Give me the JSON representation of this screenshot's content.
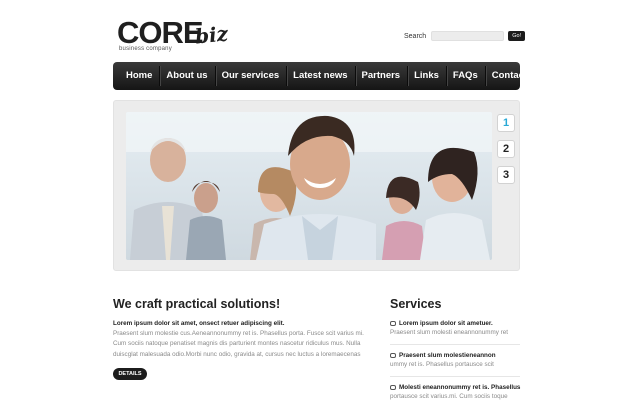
{
  "header": {
    "logo_main": "CORE",
    "logo_script": "biz",
    "tagline": "business company",
    "search_label": "Search",
    "search_value": "",
    "search_button": "Go!"
  },
  "nav": {
    "items": [
      "Home",
      "About us",
      "Our services",
      "Latest news",
      "Partners",
      "Links",
      "FAQs",
      "Contacts"
    ]
  },
  "slider": {
    "pager": [
      "1",
      "2",
      "3"
    ],
    "active_index": 1
  },
  "main": {
    "heading": "We craft practical solutions!",
    "lead": "Lorem ipsum dolor sit amet, onsect retuer adipiscing elit.",
    "body": "Praesent slum molestie cus.Aeneannonummy ret is. Phasellus porta. Fusce scit varius mi. Cum sociis natoque penatiset magnis dis parturient montes  nascetur ridiculus mus. Nulla duiscglat malesuada odio.Morbi nunc odio, gravida at, cursus nec luctus a loremaecenas",
    "details_button": "DETAILS"
  },
  "services": {
    "heading": "Services",
    "items": [
      {
        "title": "Lorem ipsum dolor sit ametuer.",
        "text": "Praesent slum molesti eneannonummy ret"
      },
      {
        "title": "Praesent slum molestieneannon",
        "text": "ummy ret is. Phasellus portausce scit"
      },
      {
        "title": "Molesti eneannonummy ret is. Phasellus",
        "text": "portausce scit varius.mi. Cum sociis toque"
      }
    ]
  },
  "colors": {
    "nav_bg": "#1c1c1c",
    "accent": "#29a9d6",
    "text_muted": "#8a8a8a"
  }
}
